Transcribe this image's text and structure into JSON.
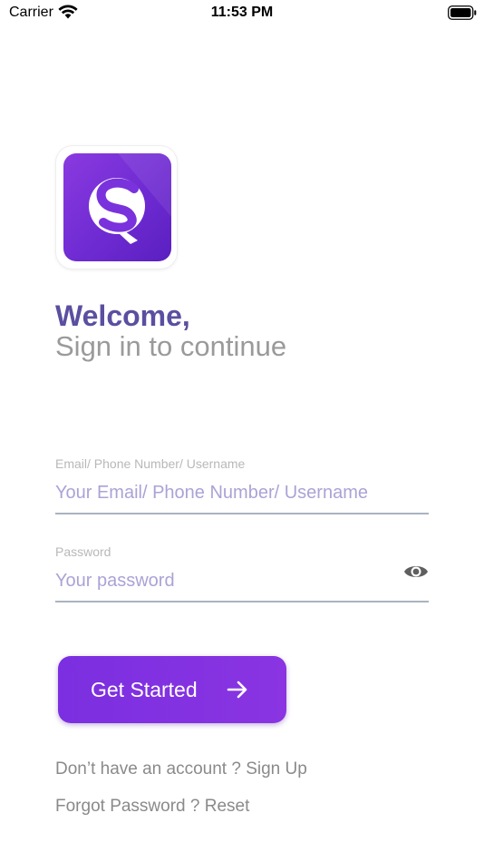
{
  "status_bar": {
    "carrier": "Carrier",
    "time": "11:53 PM"
  },
  "icons": {
    "wifi": "wifi-icon",
    "battery": "battery-icon",
    "eye": "eye-icon",
    "arrow": "arrow-right-icon",
    "logo": "app-logo"
  },
  "colors": {
    "brand": "#7b2fe0",
    "heading": "#5a4fa0",
    "placeholder": "#aaa3d6"
  },
  "header": {
    "welcome": "Welcome,",
    "subtitle": "Sign in to continue"
  },
  "form": {
    "email_label": "Email/ Phone Number/ Username",
    "email_placeholder": "Your Email/ Phone Number/ Username",
    "email_value": "",
    "password_label": "Password",
    "password_placeholder": "Your password",
    "password_value": ""
  },
  "actions": {
    "get_started": "Get Started"
  },
  "footer": {
    "signup_prompt": "Don’t have an account ? ",
    "signup_link": "Sign Up",
    "forgot_prompt": "Forgot Password ? ",
    "reset_link": "Reset"
  }
}
